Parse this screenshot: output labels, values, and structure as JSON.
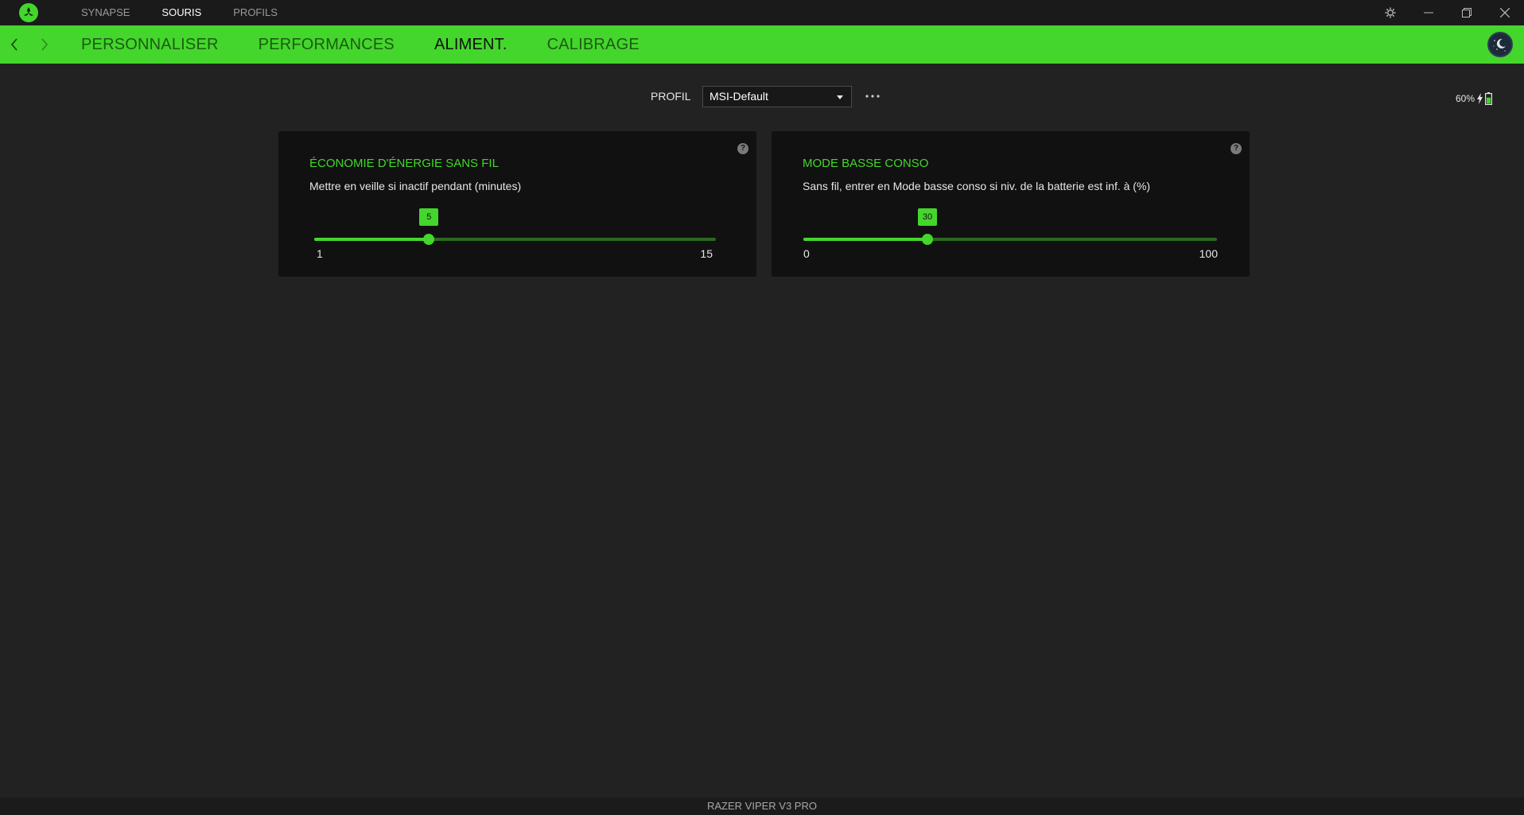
{
  "app": {
    "top_nav": [
      {
        "label": "SYNAPSE",
        "active": false
      },
      {
        "label": "SOURIS",
        "active": true
      },
      {
        "label": "PROFILS",
        "active": false
      }
    ],
    "window_controls": [
      "gear-icon",
      "minimize-icon",
      "restore-icon",
      "close-icon"
    ]
  },
  "sub_nav": [
    {
      "label": "PERSONNALISER",
      "active": false
    },
    {
      "label": "PERFORMANCES",
      "active": false
    },
    {
      "label": "ALIMENT.",
      "active": true
    },
    {
      "label": "CALIBRAGE",
      "active": false
    }
  ],
  "profile": {
    "label": "PROFIL",
    "selected": "MSI-Default"
  },
  "battery": {
    "percent_text": "60%",
    "charging": true
  },
  "cards": [
    {
      "title": "ÉCONOMIE D'ÉNERGIE SANS FIL",
      "description": "Mettre en veille si inactif pendant (minutes)",
      "slider": {
        "min": 1,
        "max": 15,
        "value": 5,
        "min_label": "1",
        "max_label": "15",
        "value_label": "5"
      }
    },
    {
      "title": "MODE BASSE CONSO",
      "description": "Sans fil, entrer en Mode basse conso si niv. de la batterie est inf. à (%)",
      "slider": {
        "min": 0,
        "max": 100,
        "value": 30,
        "min_label": "0",
        "max_label": "100",
        "value_label": "30"
      }
    }
  ],
  "footer": {
    "device_name": "RAZER VIPER V3 PRO"
  },
  "colors": {
    "accent": "#44d62c",
    "background": "#222222",
    "card": "#111111"
  }
}
